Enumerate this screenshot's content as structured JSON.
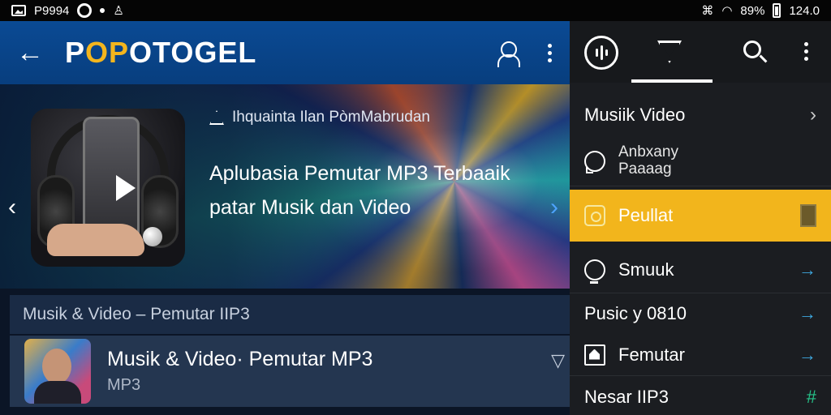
{
  "status_bar": {
    "left_text": "P9994",
    "right_battery_text": "89%",
    "time": "124.0"
  },
  "app_bar": {
    "title_p": "P",
    "title_o1": "O",
    "title_p2": "P",
    "title_rest": "OTOGEL",
    "back_icon": "arrow-left-icon",
    "account_icon": "person-icon",
    "more_icon": "more-vert-icon"
  },
  "banner": {
    "tag": "Ihquainta Ilan PòmMabrudan",
    "headline_line1": "Aplubasia Pemutar MP3 Terbaaik",
    "headline_line2": "patar Musik dan Video",
    "prev_icon": "chevron-left-icon",
    "next_icon": "chevron-right-icon"
  },
  "section": {
    "header": "Musik & Video  –  Pemutar IIP3"
  },
  "list": [
    {
      "title": "Musik & Video· Pemutar MP3",
      "subtitle": "MP3"
    }
  ],
  "right_panel": {
    "tabs": {
      "logo_icon": "audio-wave-icon",
      "active_tab_icon": "send-icon",
      "search_icon": "search-icon",
      "more_icon": "more-vert-icon"
    },
    "items": [
      {
        "label": "Musiik Video",
        "trail": "›"
      },
      {
        "label_line1": "Anbxany",
        "label_line2": "Paaaag"
      },
      {
        "label": "Peullat"
      },
      {
        "label": "Smuuk",
        "trail": "→"
      },
      {
        "label": "Pusic y 0810",
        "trail": "→"
      },
      {
        "label": "Femutar",
        "trail": "→"
      },
      {
        "label": "Nesar IIP3",
        "trail": "#"
      }
    ],
    "active_color": "#f2b51c"
  }
}
